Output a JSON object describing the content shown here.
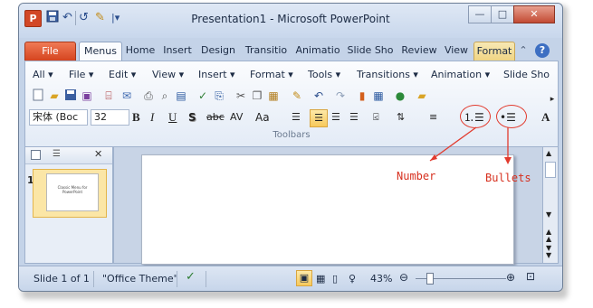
{
  "window": {
    "title": "Presentation1 - Microsoft PowerPoint",
    "app_icon": "P",
    "minimize": "—",
    "maximize": "□",
    "close": "✕"
  },
  "quick_access": {
    "save_icon": "save-icon",
    "undo_icon": "undo-icon",
    "redo_icon": "redo-icon",
    "customize_icon": "customize-icon"
  },
  "tabs": {
    "file": "File",
    "menus": "Menus",
    "home": "Home",
    "insert": "Insert",
    "design": "Design",
    "transitions": "Transitio",
    "animations": "Animatio",
    "slideshow": "Slide Sho",
    "review": "Review",
    "view": "View",
    "format": "Format"
  },
  "menu_bar": {
    "all": "All ▾",
    "file": "File ▾",
    "edit": "Edit ▾",
    "view": "View ▾",
    "insert": "Insert ▾",
    "format": "Format ▾",
    "tools": "Tools ▾",
    "transitions": "Transitions ▾",
    "animation": "Animation ▾",
    "slideshow": "Slide Sho"
  },
  "formatting": {
    "font_name": "宋体 (Boc",
    "font_size": "32",
    "bold": "B",
    "italic": "I",
    "underline": "U",
    "shadow": "S",
    "strike": "abc",
    "spacing": "AV",
    "case": "Aa"
  },
  "group_label": "Toolbars",
  "annotations": {
    "number": "Number",
    "bullets": "Bullets"
  },
  "slide_panel": {
    "slide_number": "1",
    "thumb_text": "Classic Menu for PowerPoint"
  },
  "status_bar": {
    "slide_info": "Slide 1 of 1",
    "theme": "\"Office Theme\"",
    "zoom": "43%"
  },
  "colors": {
    "accent": "#d24726",
    "annotation": "#d7301f",
    "ribbon": "#e3ebf6"
  }
}
